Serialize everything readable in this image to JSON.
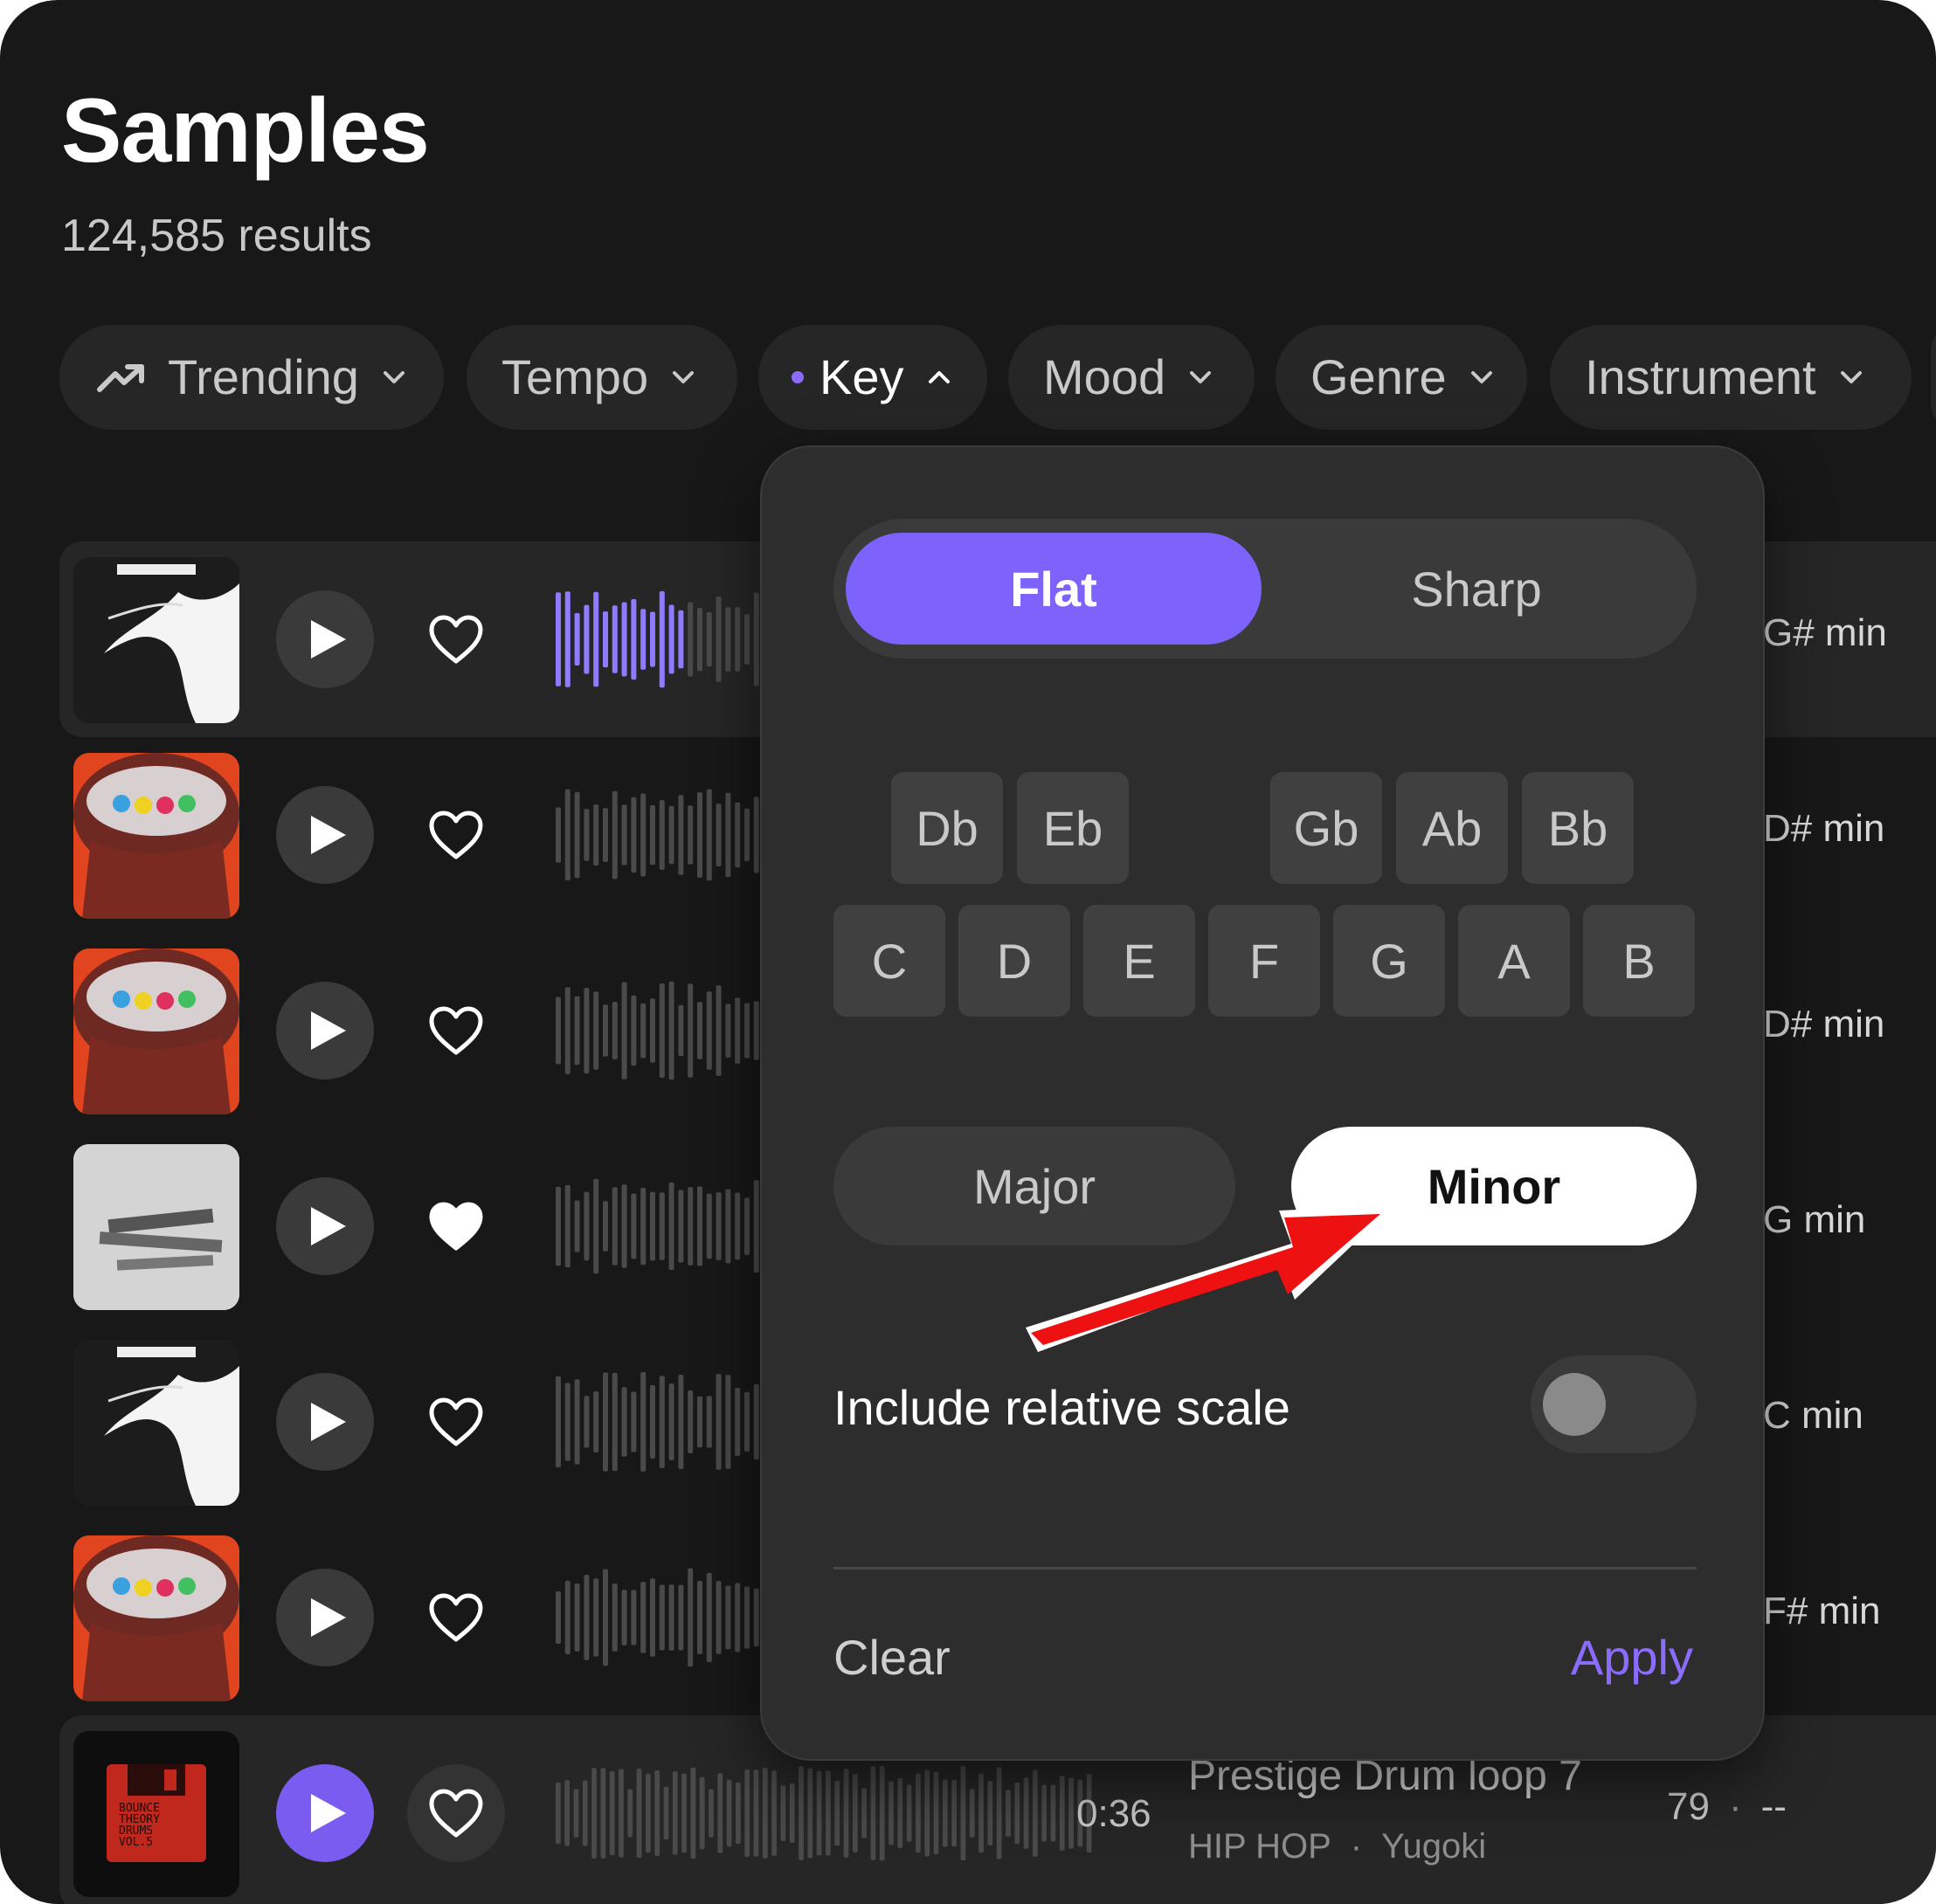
{
  "header": {
    "title": "Samples",
    "results": "124,585 results"
  },
  "filters": [
    {
      "label": "Trending",
      "icon": "trending-up-icon"
    },
    {
      "label": "Tempo",
      "icon": "chevron-down-icon"
    },
    {
      "label": "Key",
      "icon": "chevron-up-icon",
      "active": true
    },
    {
      "label": "Mood",
      "icon": "chevron-down-icon"
    },
    {
      "label": "Genre",
      "icon": "chevron-down-icon"
    },
    {
      "label": "Instrument",
      "icon": "chevron-down-icon"
    }
  ],
  "rows": [
    {
      "key": "G# min",
      "favorited": false
    },
    {
      "key": "D# min",
      "favorited": false
    },
    {
      "key": "D# min",
      "favorited": false
    },
    {
      "key": "G min",
      "favorited": true
    },
    {
      "key": "C min",
      "favorited": false
    },
    {
      "key": "F# min",
      "favorited": false
    }
  ],
  "current": {
    "duration": "0:36",
    "name": "Prestige Drum loop 7",
    "genre": "HIP HOP",
    "separator": "·",
    "artist": "Yugoki",
    "bpm": "79",
    "key": "--",
    "cover_text": "BOUNCE THEORY DRUMS VOL.5"
  },
  "key_popover": {
    "accidental": {
      "flat": "Flat",
      "sharp": "Sharp",
      "selected": "Flat"
    },
    "accidentals_row": [
      "Db",
      "Eb",
      "Gb",
      "Ab",
      "Bb"
    ],
    "naturals_row": [
      "C",
      "D",
      "E",
      "F",
      "G",
      "A",
      "B"
    ],
    "scale": {
      "major": "Major",
      "minor": "Minor",
      "selected": "Minor"
    },
    "relative_label": "Include relative scale",
    "relative_enabled": false,
    "clear": "Clear",
    "apply": "Apply"
  },
  "colors": {
    "accent": "#7d62fb",
    "background": "#181818",
    "annotation_arrow": "#ee1111"
  }
}
